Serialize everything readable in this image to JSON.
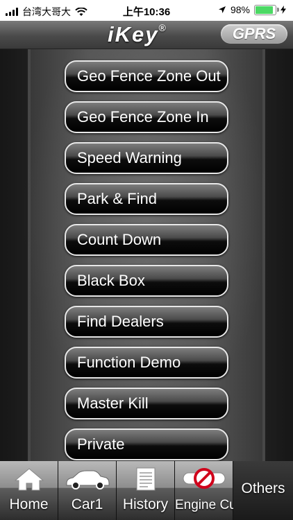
{
  "status_bar": {
    "carrier": "台湾大哥大",
    "time": "上午10:36",
    "battery": "98%",
    "battery_level": 0.98
  },
  "header": {
    "logo_text": "iKey",
    "logo_mark": "®",
    "mode_badge": "GPRS"
  },
  "menu": [
    {
      "label": "Geo Fence Zone Out"
    },
    {
      "label": "Geo Fence Zone In"
    },
    {
      "label": "Speed Warning"
    },
    {
      "label": "Park & Find"
    },
    {
      "label": "Count Down"
    },
    {
      "label": "Black Box"
    },
    {
      "label": "Find Dealers"
    },
    {
      "label": "Function Demo"
    },
    {
      "label": "Master Kill"
    },
    {
      "label": "Private"
    }
  ],
  "tabs": [
    {
      "label": "Home",
      "icon": "home-icon"
    },
    {
      "label": "Car1",
      "icon": "car-icon"
    },
    {
      "label": "History",
      "icon": "document-icon"
    },
    {
      "label": "Engine Cut",
      "icon": "engine-cut-icon"
    },
    {
      "label": "Others",
      "icon": ""
    }
  ],
  "colors": {
    "battery": "#4cd964",
    "engine_cut_symbol": "#d0021b"
  }
}
